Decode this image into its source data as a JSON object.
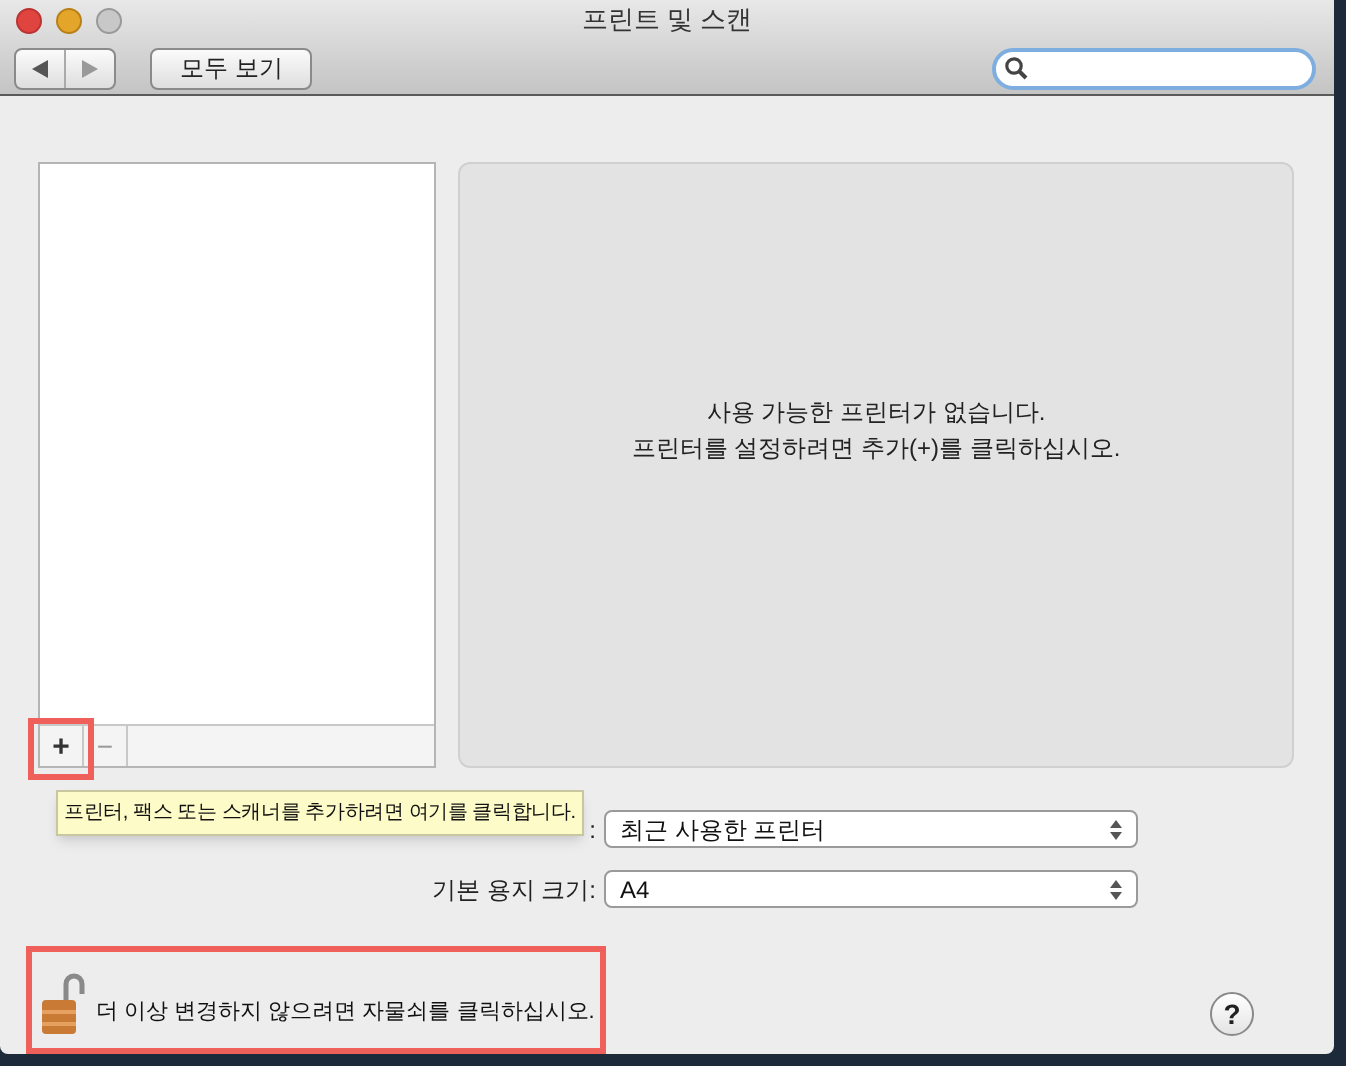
{
  "window": {
    "title": "프린트 및 스캔"
  },
  "toolbar": {
    "show_all_button": "모두 보기"
  },
  "printer_list": {
    "add_button": "+",
    "remove_button": "−",
    "highlighted_add": true
  },
  "empty_message": [
    "사용 가능한 프린터가 없습니다.",
    "프린터를 설정하려면 추가(+)를 클릭하십시오."
  ],
  "tooltip": "프린터, 팩스 또는 스캐너를 추가하려면 여기를 클릭합니다.",
  "settings": [
    {
      "label": ":",
      "value": "최근 사용한 프린터"
    },
    {
      "label": "기본 용지 크기:",
      "value": "A4"
    }
  ],
  "lock": {
    "text": "더 이상 변경하지 않으려면 자물쇠를 클릭하십시오.",
    "highlighted": true
  },
  "help_button": "?"
}
